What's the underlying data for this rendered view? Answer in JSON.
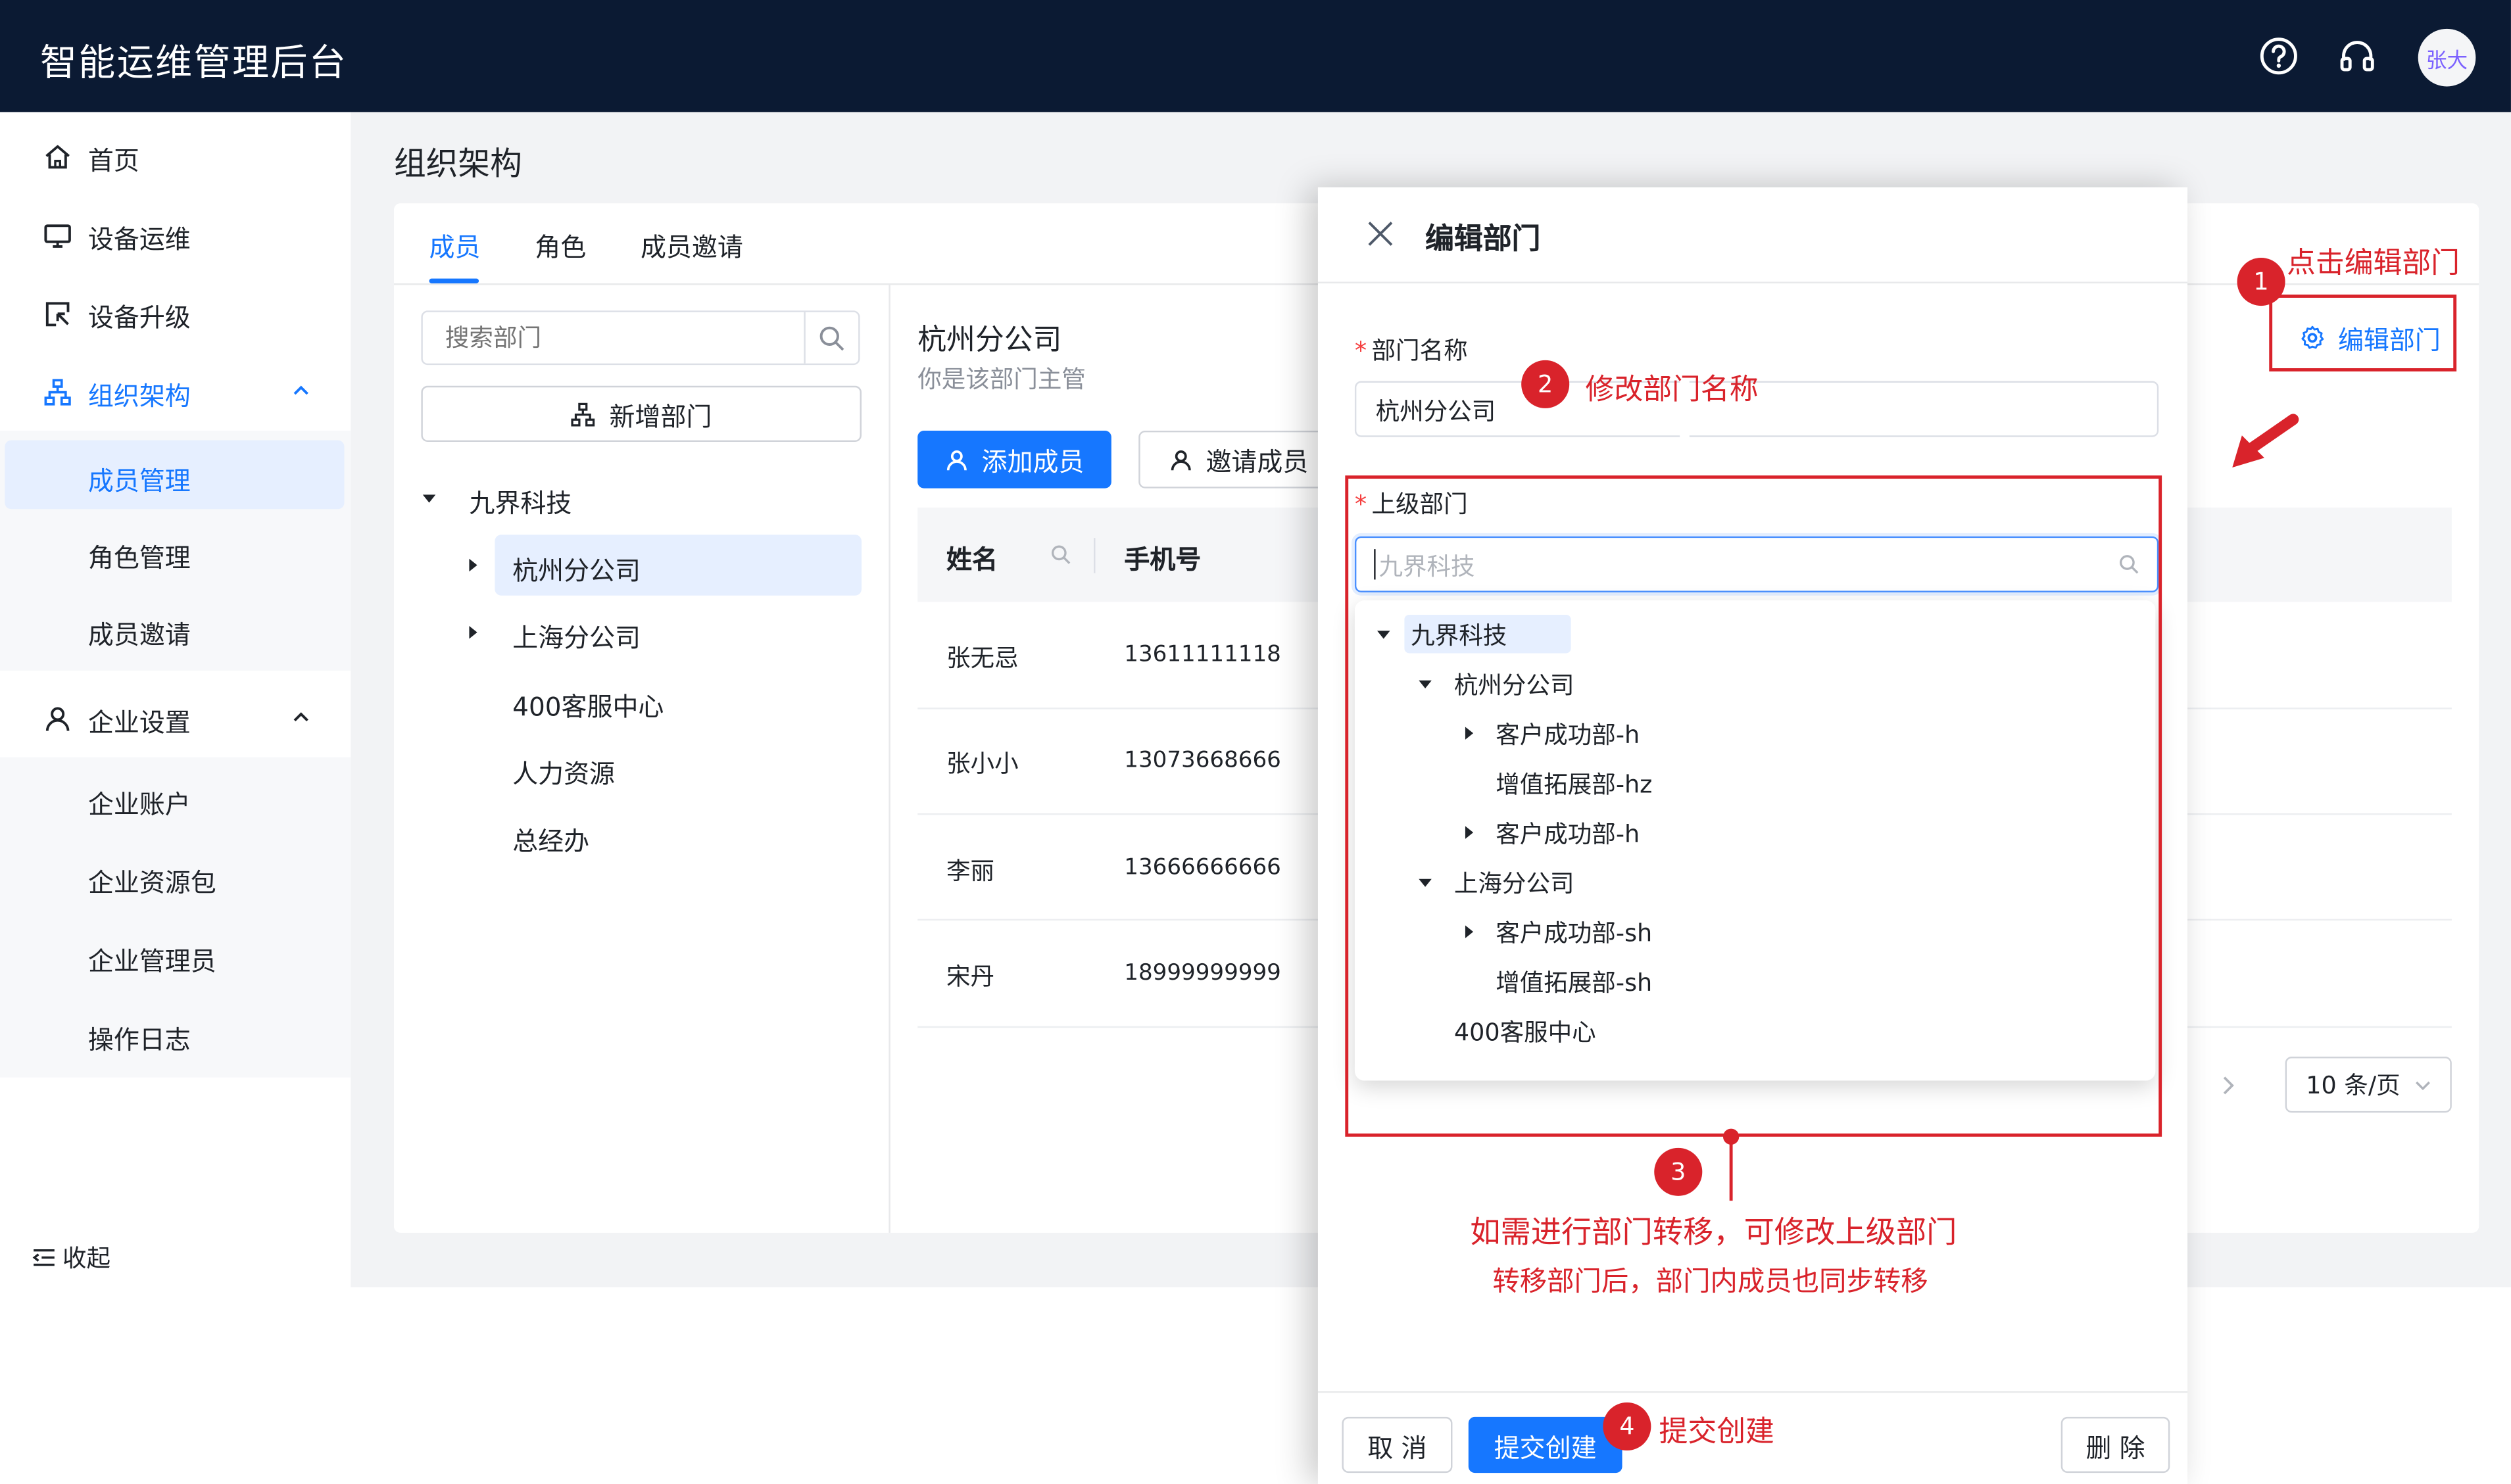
{
  "colors": {
    "topbar": "#0b1a33",
    "primary": "#1677ff",
    "annotation": "#d9232b",
    "sidebar_active_bg": "#e6efff"
  },
  "app": {
    "title": "智能运维管理后台",
    "avatar_text": "张大",
    "icons": [
      "help-circle-icon",
      "headset-icon"
    ]
  },
  "sidebar": {
    "items": [
      {
        "label": "首页",
        "icon": "home-icon"
      },
      {
        "label": "设备运维",
        "icon": "monitor-icon"
      },
      {
        "label": "设备升级",
        "icon": "upgrade-icon"
      },
      {
        "label": "组织架构",
        "icon": "org-chart-icon",
        "expanded": true
      }
    ],
    "org_sub": [
      "成员管理",
      "角色管理",
      "成员邀请"
    ],
    "enterprise": {
      "label": "企业设置",
      "icon": "user-icon",
      "expanded": true
    },
    "enterprise_sub": [
      "企业账户",
      "企业资源包",
      "企业管理员",
      "操作日志"
    ],
    "collapse_label": "收起"
  },
  "page": {
    "title": "组织架构",
    "tabs": [
      "成员",
      "角色",
      "成员邀请"
    ],
    "active_tab": "成员"
  },
  "dept_panel": {
    "search_placeholder": "搜索部门",
    "add_dept_label": "新增部门",
    "tree": {
      "root": "九界科技",
      "children": [
        "杭州分公司",
        "上海分公司",
        "400客服中心",
        "人力资源",
        "总经办"
      ],
      "selected": "杭州分公司"
    }
  },
  "member_panel": {
    "dept_name": "杭州分公司",
    "dept_note": "你是该部门主管",
    "add_member_label": "添加成员",
    "invite_member_label": "邀请成员",
    "columns": [
      "姓名",
      "手机号"
    ],
    "rows": [
      {
        "name": "张无忌",
        "phone": "13611111118"
      },
      {
        "name": "张小小",
        "phone": "13073668666"
      },
      {
        "name": "李丽",
        "phone": "13666666666"
      },
      {
        "name": "宋丹",
        "phone": "18999999999"
      }
    ],
    "edit_dept_label": "编辑部门",
    "page_size": "10 条/页"
  },
  "drawer": {
    "title": "编辑部门",
    "dept_name_label": "部门名称",
    "dept_name_value": "杭州分公司",
    "parent_label": "上级部门",
    "parent_placeholder": "九界科技",
    "tree": {
      "root": "九界科技",
      "hz": "杭州分公司",
      "hz_children": [
        "客户成功部-h",
        "增值拓展部-hz",
        "客户成功部-h"
      ],
      "sh": "上海分公司",
      "sh_children": [
        "客户成功部-sh",
        "增值拓展部-sh"
      ],
      "cs": "400客服中心"
    },
    "cancel_label": "取 消",
    "submit_label": "提交创建",
    "delete_label": "删 除"
  },
  "annotations": {
    "a1": {
      "num": "1",
      "text": "点击编辑部门"
    },
    "a2": {
      "num": "2",
      "text": "修改部门名称"
    },
    "a3": {
      "num": "3",
      "text1": "如需进行部门转移，可修改上级部门",
      "text2": "转移部门后，部门内成员也同步转移"
    },
    "a4": {
      "num": "4",
      "text": "提交创建"
    }
  }
}
